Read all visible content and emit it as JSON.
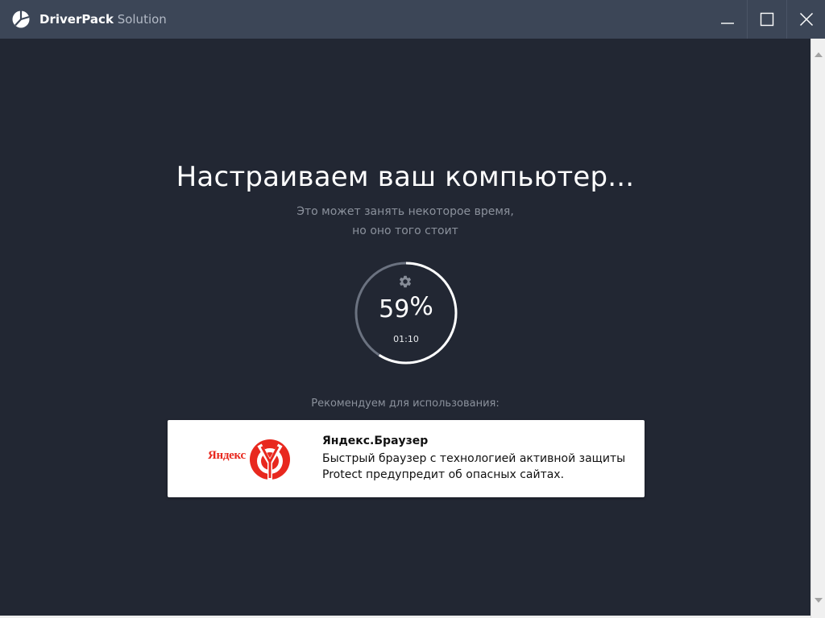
{
  "titlebar": {
    "brand": "DriverPack",
    "brand_suffix": " Solution",
    "logo_icon": "driverpack-logo-icon",
    "controls": [
      "minimize-icon",
      "maximize-icon",
      "close-icon"
    ]
  },
  "main": {
    "heading": "Настраиваем ваш компьютер...",
    "subtitle_line1": "Это может занять некоторое время,",
    "subtitle_line2": "но оно того стоит",
    "progress": {
      "value_number": "59",
      "percent_sign": "%",
      "fraction": 0.59,
      "elapsed": "01:10",
      "icon": "gear-icon"
    },
    "recommend_label": "Рекомендуем для использования:"
  },
  "recommendation": {
    "brand_word": "Яндекс",
    "title": "Яндекс.Браузер",
    "description_line1": "Быстрый браузер с технологией активной защиты",
    "description_line2": "Protect предупредит об опасных сайтах.",
    "icon": "yandex-browser-icon"
  },
  "colors": {
    "background": "#222733",
    "titlebar": "#3c4657",
    "ring_track": "#6b7280",
    "ring_fill": "#ffffff",
    "yandex_red": "#e8281e"
  }
}
